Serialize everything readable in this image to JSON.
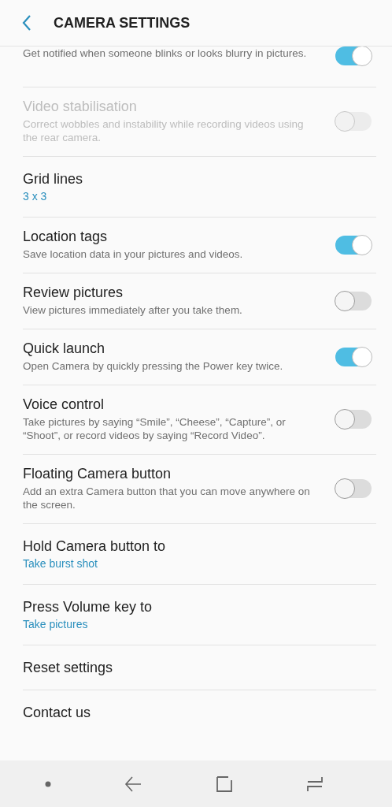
{
  "header": {
    "title": "CAMERA SETTINGS"
  },
  "settings": [
    {
      "kind": "toggle",
      "description": "Get notified when someone blinks or looks blurry in pictures.",
      "on": true,
      "disabled": false
    },
    {
      "kind": "toggle",
      "title": "Video stabilisation",
      "description": "Correct wobbles and instability while recording videos using the rear camera.",
      "on": false,
      "disabled": true
    },
    {
      "kind": "value",
      "title": "Grid lines",
      "value": "3 x 3"
    },
    {
      "kind": "toggle",
      "title": "Location tags",
      "description": "Save location data in your pictures and videos.",
      "on": true,
      "disabled": false
    },
    {
      "kind": "toggle",
      "title": "Review pictures",
      "description": "View pictures immediately after you take them.",
      "on": false,
      "disabled": false
    },
    {
      "kind": "toggle",
      "title": "Quick launch",
      "description": "Open Camera by quickly pressing the Power key twice.",
      "on": true,
      "disabled": false
    },
    {
      "kind": "toggle",
      "title": "Voice control",
      "description": "Take pictures by saying “Smile”, “Cheese”, “Capture”, or “Shoot”, or record videos by saying “Record Video”.",
      "on": false,
      "disabled": false
    },
    {
      "kind": "toggle",
      "title": "Floating Camera button",
      "description": "Add an extra Camera button that you can move anywhere on the screen.",
      "on": false,
      "disabled": false
    },
    {
      "kind": "value",
      "title": "Hold Camera button to",
      "value": "Take burst shot"
    },
    {
      "kind": "value",
      "title": "Press Volume key to",
      "value": "Take pictures"
    },
    {
      "kind": "plain",
      "title": "Reset settings"
    },
    {
      "kind": "plain",
      "title": "Contact us"
    }
  ]
}
